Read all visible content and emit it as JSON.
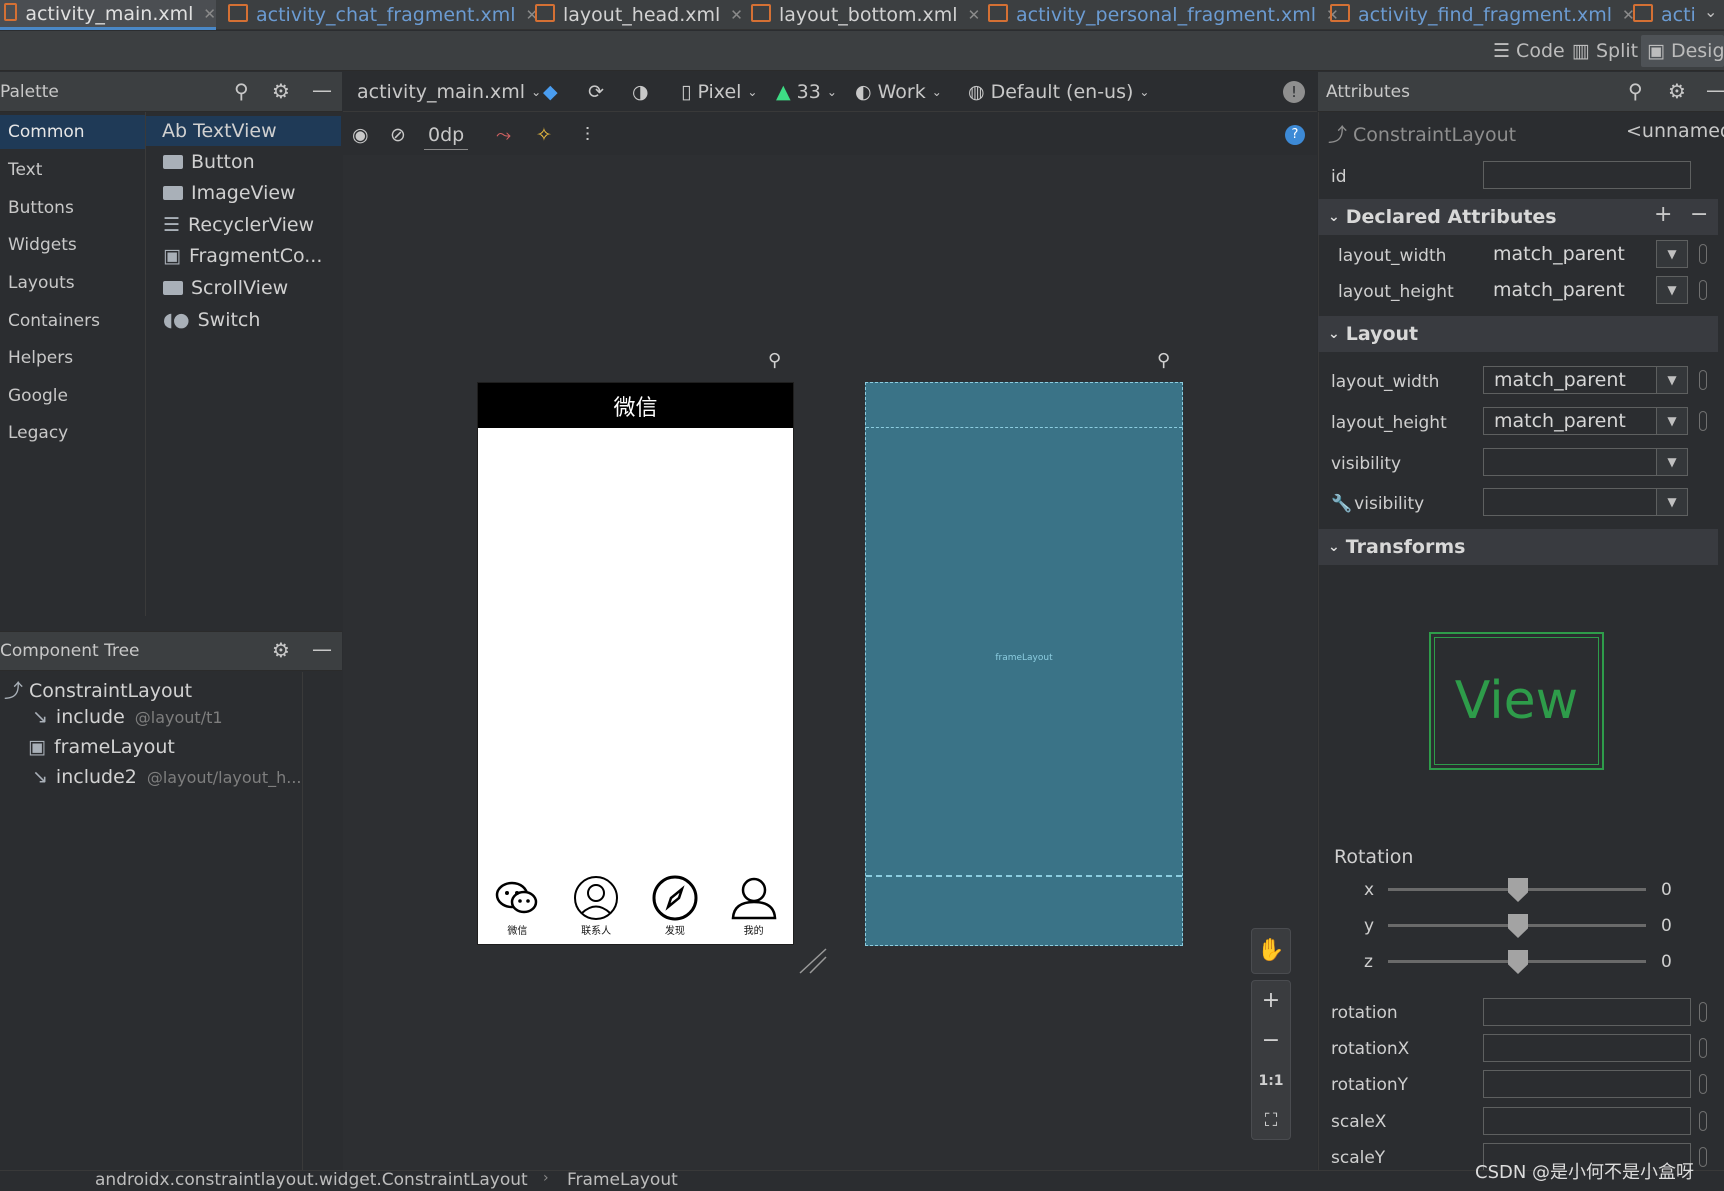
{
  "tabs": [
    {
      "label": "activity_main.xml",
      "active": true
    },
    {
      "label": "activity_chat_fragment.xml"
    },
    {
      "label": "layout_head.xml"
    },
    {
      "label": "layout_bottom.xml"
    },
    {
      "label": "activity_personal_fragment.xml"
    },
    {
      "label": "activity_find_fragment.xml"
    },
    {
      "label": "acti"
    }
  ],
  "view_modes": {
    "code": "Code",
    "split": "Split",
    "design": "Desig"
  },
  "palette": {
    "title": "Palette",
    "categories": [
      "Common",
      "Text",
      "Buttons",
      "Widgets",
      "Layouts",
      "Containers",
      "Helpers",
      "Google",
      "Legacy"
    ],
    "items": [
      "Ab TextView",
      "Button",
      "ImageView",
      "RecyclerView",
      "FragmentCo...",
      "ScrollView",
      "Switch"
    ]
  },
  "tree": {
    "title": "Component Tree",
    "items": [
      {
        "label": "ConstraintLayout",
        "sub": ""
      },
      {
        "label": "include",
        "sub": "@layout/t1"
      },
      {
        "label": "frameLayout",
        "sub": ""
      },
      {
        "label": "include2",
        "sub": "@layout/layout_h..."
      }
    ]
  },
  "toolbar": {
    "file": "activity_main.xml",
    "device": "Pixel",
    "api": "33",
    "theme": "Work",
    "locale": "Default (en-us)",
    "margin": "0dp"
  },
  "preview": {
    "title": "微信",
    "nav": [
      "微信",
      "联系人",
      "发现",
      "我的"
    ],
    "blueprint_label": "frameLayout"
  },
  "attributes": {
    "title": "Attributes",
    "component": "ConstraintLayout",
    "unnamed": "<unnamed>",
    "id_label": "id",
    "declared_title": "Declared Attributes",
    "declared": [
      {
        "name": "layout_width",
        "value": "match_parent"
      },
      {
        "name": "layout_height",
        "value": "match_parent"
      }
    ],
    "layout_title": "Layout",
    "layout": [
      {
        "name": "layout_width",
        "value": "match_parent"
      },
      {
        "name": "layout_height",
        "value": "match_parent"
      },
      {
        "name": "visibility",
        "value": ""
      },
      {
        "name": "visibility",
        "value": ""
      }
    ],
    "transforms_title": "Transforms",
    "view_preview": "View",
    "rotation_title": "Rotation",
    "rotation": [
      {
        "axis": "x",
        "value": "0"
      },
      {
        "axis": "y",
        "value": "0"
      },
      {
        "axis": "z",
        "value": "0"
      }
    ],
    "fields": [
      "rotation",
      "rotationX",
      "rotationY",
      "scaleX",
      "scaleY"
    ]
  },
  "breadcrumb": [
    "androidx.constraintlayout.widget.ConstraintLayout",
    "FrameLayout"
  ],
  "watermark": "CSDN @是小何不是小盒呀",
  "zoom": {
    "one_to_one": "1:1"
  },
  "colors": {
    "accent": "#4a88c7",
    "blueprint": "#3a7387",
    "selection": "#1f3a57"
  }
}
